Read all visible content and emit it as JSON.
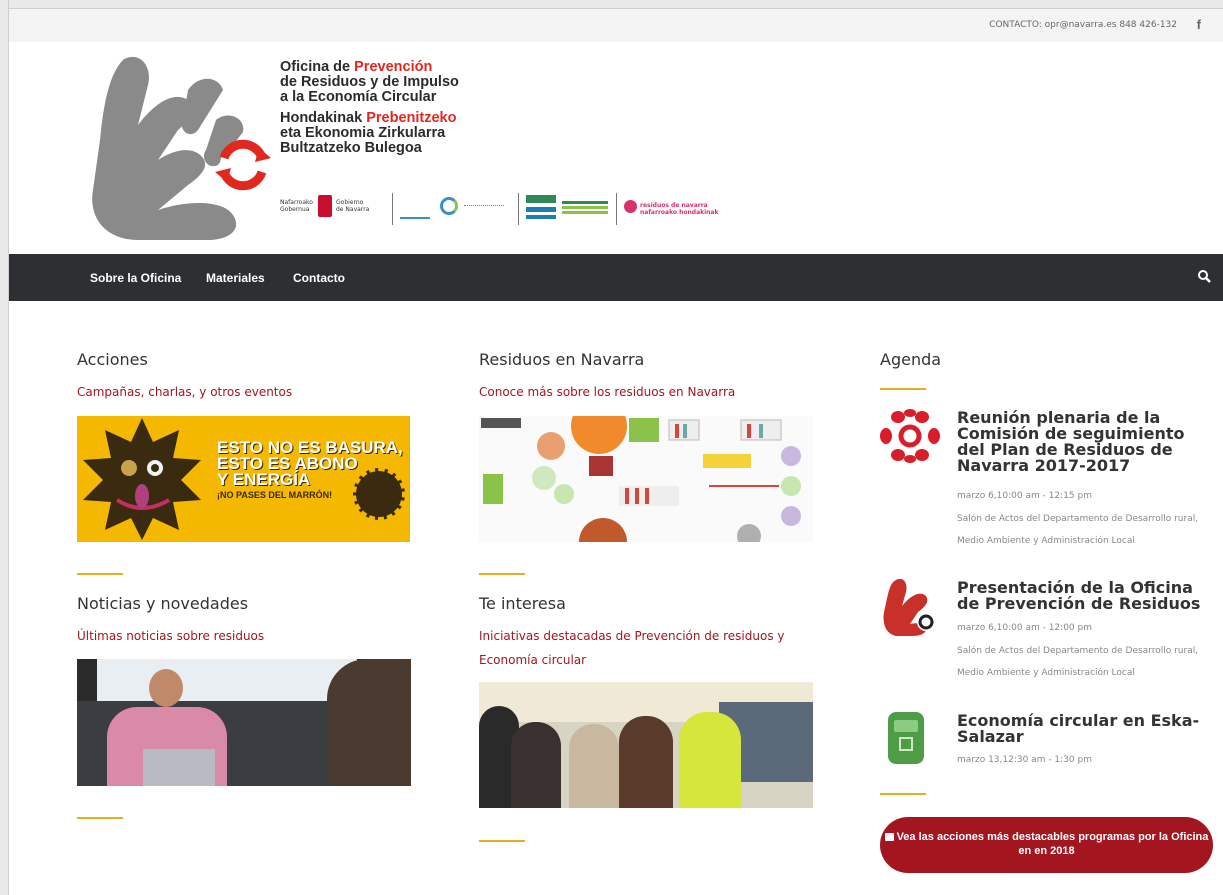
{
  "topbar": {
    "contact": "CONTACTO: opr@navarra.es 848 426-132",
    "facebook_glyph": "f"
  },
  "logo": {
    "line1a": "Oficina de ",
    "line1b": "Prevención",
    "line2": "de Residuos y de Impulso",
    "line3": "a la Economía Circular",
    "line4a": "Hondakinak ",
    "line4b": "Prebenitzeko",
    "line5": "eta Ekonomia Zirkularra",
    "line6": "Bultzatzeko Bulegoa",
    "partner1a": "Nafarroako",
    "partner1b": "Gobernua",
    "partner1c": "Gobierno",
    "partner1d": "de Navarra",
    "partner4": "residuos de navarra",
    "partner5": "nafarroako hondakinak"
  },
  "nav": {
    "items": [
      "Sobre la Oficina",
      "Materiales",
      "Contacto"
    ]
  },
  "sections": {
    "acciones": {
      "title": "Acciones",
      "subtitle": "Campañas, charlas, y otros eventos",
      "banner_l1": "ESTO NO ES BASURA,",
      "banner_l2": "ESTO ES ABONO",
      "banner_l3": "Y ENERGÍA",
      "banner_l4": "¡NO PASES DEL MARRÓN!"
    },
    "residuos": {
      "title": "Residuos en Navarra",
      "subtitle": "Conoce más sobre  los residuos en Navarra"
    },
    "noticias": {
      "title": "Noticias y novedades",
      "subtitle": "Últimas noticias sobre residuos"
    },
    "interesa": {
      "title": "Te interesa",
      "subtitle": "Iniciativas destacadas de Prevención de residuos y Economía circular"
    }
  },
  "agenda": {
    "title": "Agenda",
    "events": [
      {
        "title": "Reunión plenaria de la Comisión de seguimiento del Plan de Residuos de Navarra 2017-2017",
        "time": "marzo 6,10:00 am - 12:15 pm",
        "place": "Salón de Actos del Departamento de Desarrollo rural, Medio Ambiente y Administración Local"
      },
      {
        "title": "Presentación de la Oficina de Prevención de Residuos",
        "time": "marzo 6,10:00 am - 12:00 pm",
        "place": "Salón de Actos del Departamento de Desarrollo rural, Medio Ambiente y Administración Local"
      },
      {
        "title": "Economía circular en Eska-Salazar",
        "time": "marzo 13,12:30 am - 1:30 pm"
      }
    ],
    "cta": "Vea las acciones más destacables programas por la Oficina en en 2018"
  },
  "colors": {
    "accent": "#a3161f",
    "nav_bg": "#2d2f33",
    "rule": "#e0b020",
    "logo_red": "#e0281e"
  },
  "icons": [
    "facebook-icon",
    "search-icon",
    "calendar-icon",
    "hand-recycle-logo"
  ]
}
